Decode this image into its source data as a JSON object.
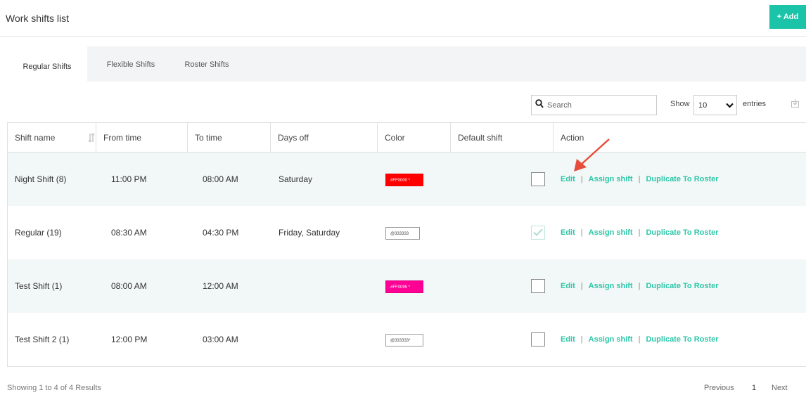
{
  "header": {
    "title": "Work shifts list",
    "add_label": "+ Add"
  },
  "tabs": [
    {
      "label": "Regular Shifts",
      "active": true
    },
    {
      "label": "Flexible Shifts",
      "active": false
    },
    {
      "label": "Roster Shifts",
      "active": false
    }
  ],
  "search": {
    "placeholder": "Search",
    "value": ""
  },
  "length": {
    "show_label": "Show",
    "value": "10",
    "entries_label": "entries"
  },
  "table": {
    "columns": [
      "Shift name",
      "From time",
      "To time",
      "Days off",
      "Color",
      "Default shift",
      "Action"
    ],
    "rows": [
      {
        "name": "Night Shift (8)",
        "from": "11:00 PM",
        "to": "08:00 AM",
        "days_off": "Saturday",
        "color_text": "#FF0000 *",
        "color_hex": "#FF0000",
        "default": false
      },
      {
        "name": "Regular (19)",
        "from": "08:30 AM",
        "to": "04:30 PM",
        "days_off": "Friday, Saturday",
        "color_text": "@333333",
        "color_hex": "#FFFFFF",
        "default": true
      },
      {
        "name": "Test Shift (1)",
        "from": "08:00 AM",
        "to": "12:00 AM",
        "days_off": "",
        "color_text": "#FF0095 *",
        "color_hex": "#FF0095",
        "default": false
      },
      {
        "name": "Test Shift 2 (1)",
        "from": "12:00 PM",
        "to": "03:00 AM",
        "days_off": "",
        "color_text": "@333333*",
        "color_hex": "#FFFFFF",
        "default": false
      }
    ],
    "actions": {
      "edit": "Edit",
      "sep": "|",
      "assign": "Assign shift",
      "duplicate": "Duplicate To Roster"
    }
  },
  "footer": {
    "showing": "Showing 1 to 4 of 4 Results",
    "previous": "Previous",
    "page": "1",
    "next": "Next"
  },
  "colors": {
    "accent": "#1bc3a8",
    "link": "#2ec6a8",
    "stripe": "#f2f8f7",
    "annotation": "#e74c3c"
  },
  "icons": [
    "search-icon",
    "chevron-down-icon",
    "export-icon",
    "sort-icon",
    "check-icon",
    "annotation-arrow-icon"
  ]
}
